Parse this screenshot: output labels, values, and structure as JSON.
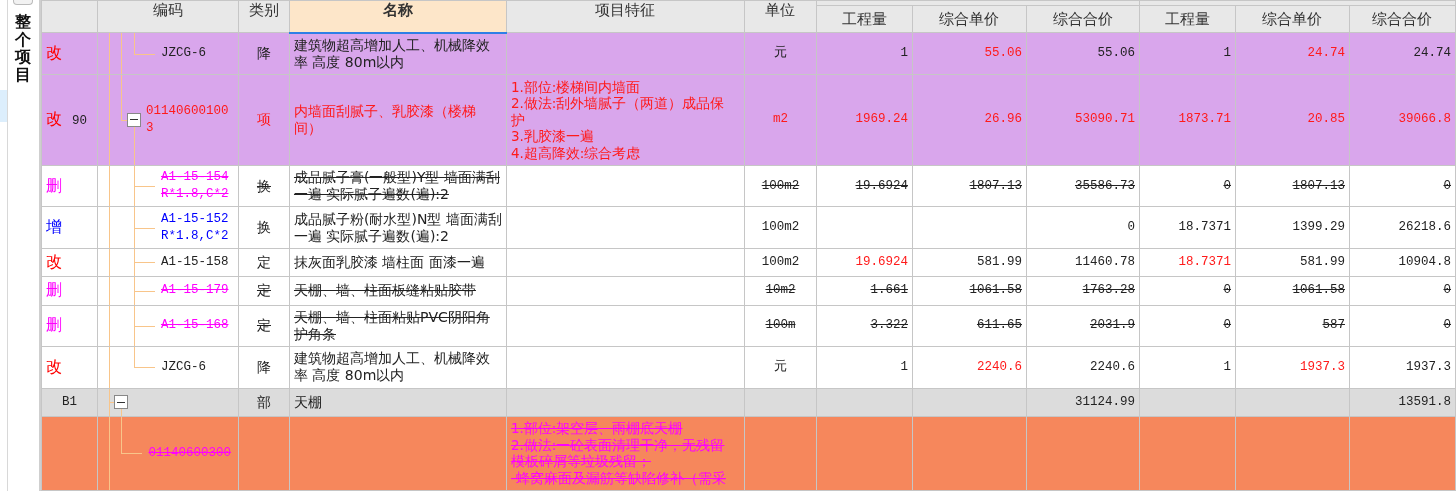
{
  "side_panel": {
    "title": "整个项目"
  },
  "columns": [
    {
      "label": "编码",
      "selected": false
    },
    {
      "label": "类别",
      "selected": false
    },
    {
      "label": "名称",
      "selected": true
    },
    {
      "label": "项目特征",
      "selected": false
    },
    {
      "label": "单位",
      "selected": false
    }
  ],
  "column_groups": [
    {
      "columns": [
        "工程量",
        "综合单价",
        "综合合价"
      ]
    },
    {
      "columns": [
        "工程量",
        "综合单价",
        "综合合价"
      ]
    }
  ],
  "rows": [
    {
      "kind": "continued",
      "children": [
        {
          "kind": "continued",
          "children": [
            {
              "kind": "modified",
              "status": {
                "text": "改",
                "color": "#ff0000"
              },
              "text_changed": false,
              "color": "#d9a6ec",
              "code": "JZCG-6",
              "type": "降",
              "name": "建筑物超高增加人工、机械降效率 高度 80m以内",
              "unit": "元",
              "values": {
                "qty_1": {
                  "text": "1",
                  "changed": false
                },
                "unit_price_1": {
                  "text": "55.06",
                  "changed": true
                },
                "total_1": {
                  "text": "55.06",
                  "changed": false
                },
                "qty_2": {
                  "text": "1",
                  "changed": false
                },
                "unit_price_2": {
                  "text": "24.74",
                  "changed": true
                },
                "total_2": {
                  "text": "24.74",
                  "changed": false
                }
              }
            }
          ]
        },
        {
          "kind": "modified",
          "status": {
            "text": "改",
            "color": "#ff0000"
          },
          "index": "90",
          "text_changed": true,
          "expanded": true,
          "color": "#d9a6ec",
          "code": "011406001003",
          "type": "项",
          "name": "内墙面刮腻子、乳胶漆（楼梯间）",
          "features": [
            "1.部位:楼梯间内墙面",
            "2.做法:刮外墙腻子（两道）成品保护",
            "3.乳胶漆一遍",
            "4.超高降效:综合考虑"
          ],
          "unit": "m2",
          "values": {
            "qty_1": {
              "text": "1969.24",
              "changed": true
            },
            "unit_price_1": {
              "text": "26.96",
              "changed": true
            },
            "total_1": {
              "text": "53090.71",
              "changed": true
            },
            "qty_2": {
              "text": "1873.71",
              "changed": true
            },
            "unit_price_2": {
              "text": "20.85",
              "changed": true
            },
            "total_2": {
              "text": "39066.8",
              "changed": true
            }
          },
          "children": [
            {
              "kind": "deleted",
              "status": {
                "text": "删",
                "color": "#ff00ff"
              },
              "text_changed": false,
              "code": "A1-15-154 R*1.8,C*2",
              "type": "换",
              "name": "成品腻子膏(一般型)Y型 墙面满刮一遍  实际腻子遍数(遍):2",
              "unit": "100m2",
              "values": {
                "qty_1": {
                  "text": "19.6924",
                  "changed": false
                },
                "unit_price_1": {
                  "text": "1807.13",
                  "changed": false
                },
                "total_1": {
                  "text": "35586.73",
                  "changed": false
                },
                "qty_2": {
                  "text": "0",
                  "changed": false
                },
                "unit_price_2": {
                  "text": "1807.13",
                  "changed": false
                },
                "total_2": {
                  "text": "0",
                  "changed": false
                }
              }
            },
            {
              "kind": "added",
              "status": {
                "text": "增",
                "color": "#0000ff"
              },
              "text_changed": false,
              "code": "A1-15-152 R*1.8,C*2",
              "type": "换",
              "name": "成品腻子粉(耐水型)N型 墙面满刮一遍  实际腻子遍数(遍):2",
              "unit": "100m2",
              "values": {
                "total_1": {
                  "text": "0",
                  "changed": false
                },
                "qty_2": {
                  "text": "18.7371",
                  "changed": false
                },
                "unit_price_2": {
                  "text": "1399.29",
                  "changed": false
                },
                "total_2": {
                  "text": "26218.6",
                  "changed": false
                }
              }
            },
            {
              "kind": "modified",
              "status": {
                "text": "改",
                "color": "#ff0000"
              },
              "text_changed": false,
              "code": "A1-15-158",
              "type": "定",
              "name": "抹灰面乳胶漆 墙柱面 面漆一遍",
              "unit": "100m2",
              "values": {
                "qty_1": {
                  "text": "19.6924",
                  "changed": true
                },
                "unit_price_1": {
                  "text": "581.99",
                  "changed": false
                },
                "total_1": {
                  "text": "11460.78",
                  "changed": false
                },
                "qty_2": {
                  "text": "18.7371",
                  "changed": true
                },
                "unit_price_2": {
                  "text": "581.99",
                  "changed": false
                },
                "total_2": {
                  "text": "10904.8",
                  "changed": false
                }
              }
            },
            {
              "kind": "deleted",
              "status": {
                "text": "删",
                "color": "#ff00ff"
              },
              "text_changed": false,
              "code": "A1-15-179",
              "type": "定",
              "name": "天棚、墙、柱面板缝粘贴胶带",
              "unit": "10m2",
              "values": {
                "qty_1": {
                  "text": "1.661",
                  "changed": false
                },
                "unit_price_1": {
                  "text": "1061.58",
                  "changed": false
                },
                "total_1": {
                  "text": "1763.28",
                  "changed": false
                },
                "qty_2": {
                  "text": "0",
                  "changed": false
                },
                "unit_price_2": {
                  "text": "1061.58",
                  "changed": false
                },
                "total_2": {
                  "text": "0",
                  "changed": false
                }
              }
            },
            {
              "kind": "deleted",
              "status": {
                "text": "删",
                "color": "#ff00ff"
              },
              "text_changed": false,
              "code": "A1-15-168",
              "type": "定",
              "name": "天棚、墙、柱面粘贴PVC阴阳角护角条",
              "unit": "100m",
              "values": {
                "qty_1": {
                  "text": "3.322",
                  "changed": false
                },
                "unit_price_1": {
                  "text": "611.65",
                  "changed": false
                },
                "total_1": {
                  "text": "2031.9",
                  "changed": false
                },
                "qty_2": {
                  "text": "0",
                  "changed": false
                },
                "unit_price_2": {
                  "text": "587",
                  "changed": false
                },
                "total_2": {
                  "text": "0",
                  "changed": false
                }
              }
            },
            {
              "kind": "modified",
              "status": {
                "text": "改",
                "color": "#ff0000"
              },
              "text_changed": false,
              "code": "JZCG-6",
              "type": "降",
              "name": "建筑物超高增加人工、机械降效率 高度 80m以内",
              "unit": "元",
              "values": {
                "qty_1": {
                  "text": "1",
                  "changed": false
                },
                "unit_price_1": {
                  "text": "2240.6",
                  "changed": true
                },
                "total_1": {
                  "text": "2240.6",
                  "changed": false
                },
                "qty_2": {
                  "text": "1",
                  "changed": false
                },
                "unit_price_2": {
                  "text": "1937.3",
                  "changed": true
                },
                "total_2": {
                  "text": "1937.3",
                  "changed": false
                }
              }
            }
          ]
        }
      ]
    },
    {
      "kind": "section",
      "code": "B1",
      "expanded": true,
      "color": "#dcdcdc",
      "type": "部",
      "name": "天棚",
      "values": {
        "total_1": {
          "text": "31124.99",
          "changed": false
        },
        "total_2": {
          "text": "13591.8",
          "changed": false
        }
      },
      "children": [
        {
          "kind": "deleted",
          "color": "#f6875c",
          "code": "01140600300",
          "features": [
            "1.部位:架空层、雨棚底天棚",
            "2.做法:一砼表面清理干净，无残留模板碎屑等垃圾残留；",
            "-蜂窝麻面及漏筋等缺陷修补（需采"
          ]
        }
      ]
    }
  ]
}
